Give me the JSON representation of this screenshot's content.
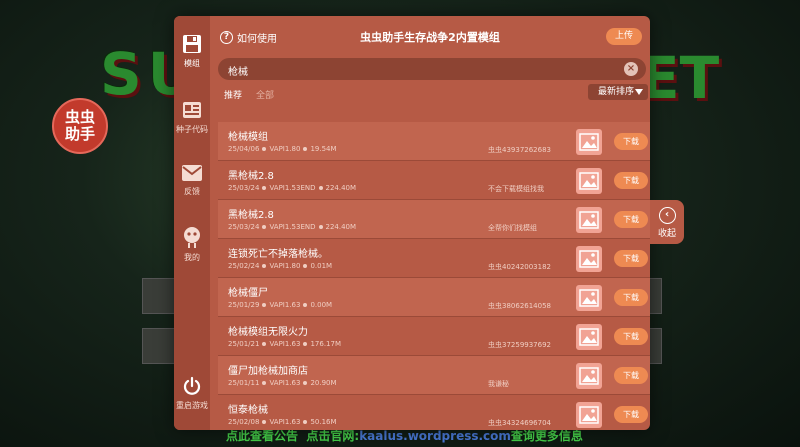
{
  "background": {
    "game_title_left": "SU",
    "game_title_right": "ET",
    "badge": "虫虫助手",
    "footer": {
      "notice": "点此查看公告",
      "site_prefix": "点击官网:",
      "site": "kaalus.wordpress.com",
      "more": "查询更多信息"
    }
  },
  "sidebar": {
    "items": [
      {
        "label": "模组",
        "icon": "save-icon"
      },
      {
        "label": "种子代码",
        "icon": "newspaper-icon"
      },
      {
        "label": "反馈",
        "icon": "mail-icon"
      },
      {
        "label": "我的",
        "icon": "user-icon"
      },
      {
        "label": "重启游戏",
        "icon": "power-icon"
      }
    ]
  },
  "header": {
    "help_label": "如何使用",
    "title": "虫虫助手生存战争2内置模组",
    "upload_label": "上传"
  },
  "search": {
    "value": "枪械"
  },
  "tabs": {
    "recommended": "推荐",
    "all": "全部"
  },
  "sort": {
    "selected": "最新排序"
  },
  "collapse": {
    "label": "收起"
  },
  "mods": [
    {
      "name": "枪械模组",
      "date": "25/04/06",
      "api": "VAPI1.80",
      "size": "19.54M",
      "author": "虫虫43937262683",
      "download": "下载"
    },
    {
      "name": "黑枪械2.8",
      "date": "25/03/24",
      "api": "VAPI1.53END",
      "size": "224.40M",
      "author": "不会下载模组找我",
      "download": "下载"
    },
    {
      "name": "黑枪械2.8",
      "date": "25/03/24",
      "api": "VAPI1.53END",
      "size": "224.40M",
      "author": "全帮你们找模组",
      "download": "下载"
    },
    {
      "name": "连锁死亡不掉落枪械。",
      "date": "25/02/24",
      "api": "VAPI1.80",
      "size": "0.01M",
      "author": "虫虫40242003182",
      "download": "下载"
    },
    {
      "name": "枪械僵尸",
      "date": "25/01/29",
      "api": "VAPI1.63",
      "size": "0.00M",
      "author": "虫虫38062614058",
      "download": "下载"
    },
    {
      "name": "枪械模组无限火力",
      "date": "25/01/21",
      "api": "VAPI1.63",
      "size": "176.17M",
      "author": "虫虫37259937692",
      "download": "下载"
    },
    {
      "name": "僵尸加枪械加商店",
      "date": "25/01/11",
      "api": "VAPI1.63",
      "size": "20.90M",
      "author": "我谦秘",
      "download": "下载"
    },
    {
      "name": "恒泰枪械",
      "date": "25/02/08",
      "api": "VAPI1.63",
      "size": "50.16M",
      "author": "虫虫34324696704",
      "download": "下载"
    }
  ],
  "colors": {
    "panel": "#b65a45",
    "sidebar": "#9f4937",
    "accent_button": "#ee8a52",
    "search_bg": "#8d4433"
  }
}
